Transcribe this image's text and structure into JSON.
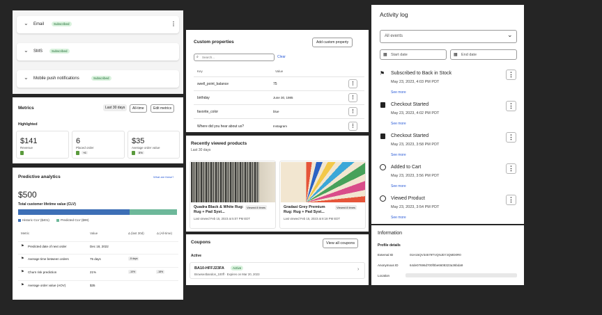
{
  "subscriptions": {
    "items": [
      {
        "label": "Email",
        "badge": "Subscribed"
      },
      {
        "label": "SMS",
        "badge": "Subscribed"
      },
      {
        "label": "Mobile push notifications",
        "badge": "Subscribed"
      }
    ],
    "more": "⋮"
  },
  "metrics": {
    "title": "Metrics",
    "tabs": [
      "Last 30 days",
      "All-time"
    ],
    "edit": "Edit metrics",
    "highlighted": "Highlighted",
    "cards": [
      {
        "value": "$141",
        "label": "Revenue",
        "trend": ""
      },
      {
        "value": "6",
        "label": "Placed order",
        "trend": "+6"
      },
      {
        "value": "$35",
        "label": "Average order value",
        "trend": "8%"
      }
    ]
  },
  "predictive": {
    "title": "Predictive analytics",
    "link": "What are these?",
    "value": "$500",
    "value_label": "Total customer lifetime value (CLV)",
    "bar": {
      "historic": 0.7,
      "predicted": 0.3
    },
    "legend": [
      "Historic CLV ($401)",
      "Predicted CLV ($99)"
    ],
    "headers": [
      "Metric",
      "Value",
      "Δ (last 30d)",
      "Δ (All-time)"
    ],
    "rows": [
      {
        "metric": "Predicted date of next order",
        "value": "Dec 18, 2022",
        "d30": "",
        "dall": ""
      },
      {
        "metric": "Average time between orders",
        "value": "75 days",
        "d30": "-5 days",
        "dall": ""
      },
      {
        "metric": "Churn risk prediction",
        "value": "21%",
        "d30": "-10%",
        "dall": "-18%"
      },
      {
        "metric": "Average order value (AOV)",
        "value": "$35",
        "d30": "",
        "dall": ""
      }
    ]
  },
  "custom": {
    "title": "Custom properties",
    "add": "Add custom property",
    "search_placeholder": "Search...",
    "clear": "Clear",
    "headers": [
      "Key",
      "Value"
    ],
    "rows": [
      {
        "key": "swell_point_balance",
        "value": "75"
      },
      {
        "key": "birthday",
        "value": "June 30, 1985"
      },
      {
        "key": "favorite_color",
        "value": "blue"
      },
      {
        "key": "Where did you hear about us?",
        "value": "Instagram"
      }
    ]
  },
  "recent": {
    "title": "Recently viewed products",
    "subtitle": "Last 30 days",
    "products": [
      {
        "name": "Quadra Black & White Rug: Rug + Pad Syst...",
        "badge": "Viewed 8 times",
        "meta": "Last viewed Feb 15, 2023 at 5:07 PM EDT"
      },
      {
        "name": "Gradasi Grey Premium Rug: Rug + Pad Syst...",
        "badge": "Viewed 8 times",
        "meta": "Last viewed Feb 15, 2023 at 8:18 PM EDT"
      }
    ]
  },
  "coupons": {
    "title": "Coupons",
    "view_all": "View all coupons",
    "section": "Active",
    "code": "BA10-HFFJ23FA",
    "status": "Active",
    "meta": "Browse4bandon_100ff · Expires on Mar 20, 2023"
  },
  "activity": {
    "title": "Activity log",
    "filter": "All events",
    "start_placeholder": "Start date",
    "end_placeholder": "End date",
    "events": [
      {
        "title": "Subscribed to Back in Stock",
        "time": "May 23, 2023, 4:03 PM PDT",
        "more": "See more",
        "icon": "flag-icon"
      },
      {
        "title": "Checkout Started",
        "time": "May 23, 2023, 4:02 PM PDT",
        "more": "See more",
        "icon": "shopify-bag-icon"
      },
      {
        "title": "Checkout Started",
        "time": "May 23, 2023, 3:58 PM PDT",
        "more": "See more",
        "icon": "shopify-bag-icon"
      },
      {
        "title": "Added to Cart",
        "time": "May 23, 2023, 3:56 PM PDT",
        "more": "See more",
        "icon": "target-icon"
      },
      {
        "title": "Viewed Product",
        "time": "May 23, 2023, 3:54 PM PDT",
        "more": "See more",
        "icon": "target-icon"
      }
    ]
  },
  "info": {
    "title": "Information",
    "section": "Profile details",
    "rows": [
      {
        "label": "External ID",
        "value": "01H15QV34579TVQNJD7JQMD0R0"
      },
      {
        "label": "Anonymous ID",
        "value": "64de07696d700f0be6608323a36bda9"
      },
      {
        "label": "Location",
        "value": ""
      }
    ]
  },
  "colors": {
    "historic": "#3d6fb6",
    "predicted": "#6db89a",
    "badge": "#d9f2dd"
  }
}
